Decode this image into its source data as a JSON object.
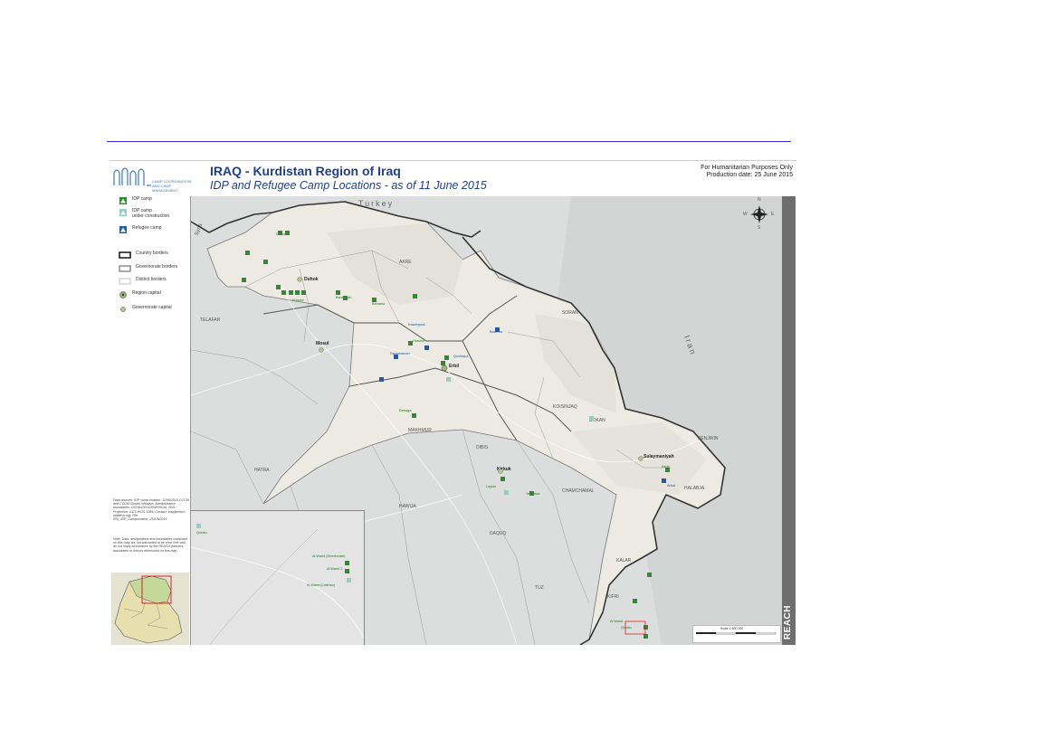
{
  "header": {
    "title": "IRAQ - Kurdistan Region of Iraq",
    "subtitle": "IDP and Refugee Camp Locations - as of 11 June 2015",
    "purpose": "For Humanitarian Purposes Only",
    "production": "Production date: 25 June  2015",
    "logo_text": "CAMP COORDINATION AND CAMP MANAGEMENT"
  },
  "legend": {
    "idp_camp": "IDP camp",
    "idp_construction_1": "IDP camp",
    "idp_construction_2": "under construction",
    "refugee_camp": "Refugee camp",
    "country_borders": "Country borders",
    "governorate_borders": "Governorate borders",
    "district_borders": "District borders",
    "region_capital": "Region capital",
    "governorate_capital": "Governorate capital"
  },
  "notes": {
    "sources": "Data sources: IDP camp location: 11/06/2015 CCCM and CCCM Cluster Initiative; Administrative boundaries: OCHA/GEOGRAPHICAL 2011; Projection: GCS WGS 1984; Contact: iraq@reach-initiative.org; File: IRQ_IDP_Camplocation_25JUN2015",
    "disclaimer": "Note: Data, designations and boundaries contained on this map are not warranted to be error-free and do not imply acceptance by the REACH partners, associates or donors mentioned on this map."
  },
  "map_labels": {
    "turkey": "Turkey",
    "iran": "Iran",
    "syria": "Syria",
    "duhok": "Duhok",
    "mosul": "Mosul",
    "erbil": "Erbil",
    "kirkuk": "Kirkuk",
    "sulaymaniyah": "Sulaymaniyah",
    "telafar": "TELAFAR",
    "makhmur": "MAKHMUR",
    "koisnjaq": "KOISINJAQ",
    "dokan": "DOKAN",
    "chamchamal": "CHAMCHAMAL",
    "kalar": "KALAR",
    "akre": "AKRE",
    "soran": "SORAN",
    "hatra": "HATRA",
    "hawija": "HAWIJA",
    "dibis": "DIBIS",
    "daquq": "DAQUQ",
    "tuz": "TUZ",
    "kifri": "KIFRI",
    "penjwin": "PENJWIN",
    "halabja": "HALABJA"
  },
  "camps": {
    "kawergosk": "Kawergosk",
    "darashakran": "Darashakran",
    "basirma": "Basirma",
    "qushtapa": "Qushtapa",
    "baharka": "Baharka",
    "harshm": "Harshm",
    "debaga": "Debaga",
    "arbat": "Arbat",
    "ashti": "Ashti",
    "laylan": "Laylan",
    "yahyawa": "Yahyawa",
    "domiz": "Domiz",
    "khanke": "Khanke",
    "bardarash": "Bardarash",
    "alwand": "Al Wand",
    "qoratu": "Qoratu"
  },
  "inset": {
    "a": "Al Wand (Directorate)",
    "b": "Al Wand 2",
    "c": "Al Wand (Lalshan)",
    "d": "Qoratu"
  },
  "compass": {
    "n": "N",
    "s": "S",
    "e": "E",
    "w": "W"
  },
  "scale": {
    "text": "Scale 1:800,000"
  },
  "brand": {
    "reach": "REACH"
  },
  "colors": {
    "idp": "#2e8b2e",
    "refugee": "#1e5aa8",
    "region": "#eceae2",
    "outside": "#dcdedd",
    "title": "#1f3f8f"
  }
}
